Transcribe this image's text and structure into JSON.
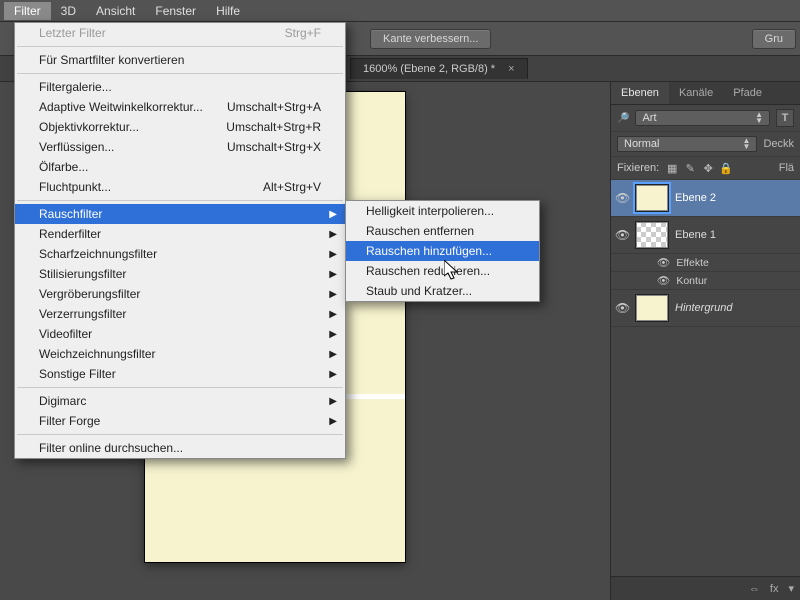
{
  "menubar": {
    "items": [
      "Filter",
      "3D",
      "Ansicht",
      "Fenster",
      "Hilfe"
    ],
    "active": 0
  },
  "toolbar": {
    "refine": "Kante verbessern...",
    "group": "Gru"
  },
  "doctab": {
    "title": "1600% (Ebene 2, RGB/8) *",
    "close": "×"
  },
  "panels": {
    "tabs": [
      "Ebenen",
      "Kanäle",
      "Pfade"
    ],
    "kind_label": "Art",
    "blend": "Normal",
    "opacity_label": "Deckk",
    "lock_label": "Fixieren:",
    "fill_label": "Flä",
    "layers": [
      {
        "name": "Ebene 2",
        "thumb": "solid",
        "selected": true
      },
      {
        "name": "Ebene 1",
        "thumb": "checker",
        "selected": false,
        "fx": {
          "title": "Effekte",
          "items": [
            "Kontur"
          ]
        }
      },
      {
        "name": "Hintergrund",
        "thumb": "solid",
        "italic": true
      }
    ],
    "footer_fx": "fx"
  },
  "dropdown": {
    "items": [
      {
        "label": "Letzter Filter",
        "shortcut": "Strg+F",
        "disabled": true
      },
      {
        "sep": true
      },
      {
        "label": "Für Smartfilter konvertieren"
      },
      {
        "sep": true
      },
      {
        "label": "Filtergalerie..."
      },
      {
        "label": "Adaptive Weitwinkelkorrektur...",
        "shortcut": "Umschalt+Strg+A"
      },
      {
        "label": "Objektivkorrektur...",
        "shortcut": "Umschalt+Strg+R"
      },
      {
        "label": "Verflüssigen...",
        "shortcut": "Umschalt+Strg+X"
      },
      {
        "label": "Ölfarbe..."
      },
      {
        "label": "Fluchtpunkt...",
        "shortcut": "Alt+Strg+V"
      },
      {
        "sep": true
      },
      {
        "label": "Rauschfilter",
        "submenu": true,
        "hl": true
      },
      {
        "label": "Renderfilter",
        "submenu": true
      },
      {
        "label": "Scharfzeichnungsfilter",
        "submenu": true
      },
      {
        "label": "Stilisierungsfilter",
        "submenu": true
      },
      {
        "label": "Vergröberungsfilter",
        "submenu": true
      },
      {
        "label": "Verzerrungsfilter",
        "submenu": true
      },
      {
        "label": "Videofilter",
        "submenu": true
      },
      {
        "label": "Weichzeichnungsfilter",
        "submenu": true
      },
      {
        "label": "Sonstige Filter",
        "submenu": true
      },
      {
        "sep": true
      },
      {
        "label": "Digimarc",
        "submenu": true
      },
      {
        "label": "Filter Forge",
        "submenu": true
      },
      {
        "sep": true
      },
      {
        "label": "Filter online durchsuchen..."
      }
    ]
  },
  "submenu": {
    "items": [
      {
        "label": "Helligkeit interpolieren..."
      },
      {
        "label": "Rauschen entfernen"
      },
      {
        "label": "Rauschen hinzufügen...",
        "hl": true
      },
      {
        "label": "Rauschen reduzieren..."
      },
      {
        "label": "Staub und Kratzer..."
      }
    ]
  }
}
